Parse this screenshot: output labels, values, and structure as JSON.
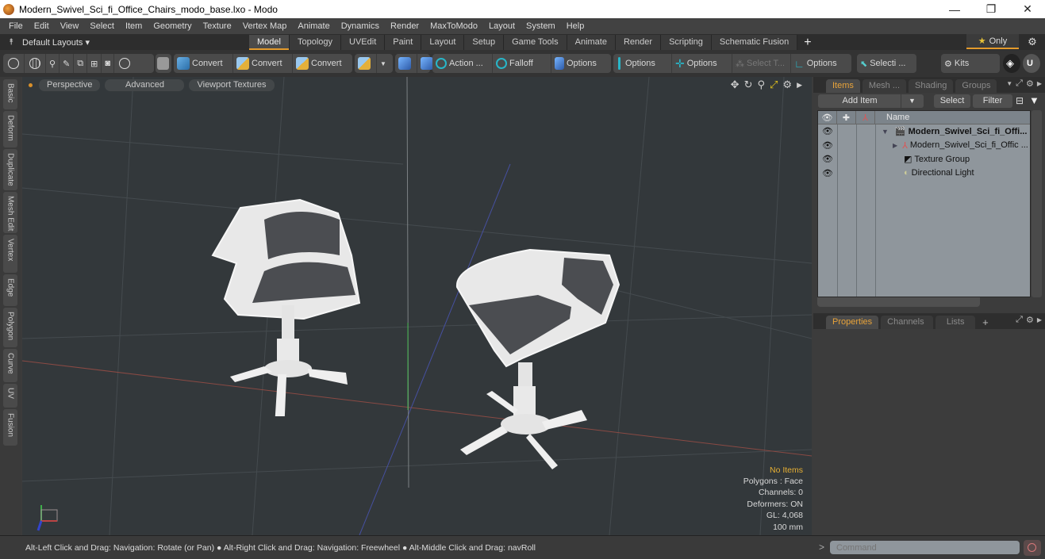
{
  "window": {
    "title": "Modern_Swivel_Sci_fi_Office_Chairs_modo_base.lxo - Modo",
    "minimize": "—",
    "restore": "❐",
    "close": "✕"
  },
  "menu": [
    "File",
    "Edit",
    "View",
    "Select",
    "Item",
    "Geometry",
    "Texture",
    "Vertex Map",
    "Animate",
    "Dynamics",
    "Render",
    "MaxToModo",
    "Layout",
    "System",
    "Help"
  ],
  "layout_bar": {
    "default_layouts": "Default Layouts ▾",
    "tabs": [
      "Model",
      "Topology",
      "UVEdit",
      "Paint",
      "Layout",
      "Setup",
      "Game Tools",
      "Animate",
      "Render",
      "Scripting",
      "Schematic Fusion"
    ],
    "active_tab": "Model",
    "add": "+",
    "only": "Only",
    "star": "★",
    "gear": "⚙"
  },
  "toolbar": {
    "convert1": "Convert",
    "convert2": "Convert",
    "convert3": "Convert",
    "action": "Action ...",
    "falloff": "Falloff",
    "options1": "Options",
    "options2": "Options",
    "options3": "Options",
    "select_t": "Select T...",
    "options4": "Options",
    "selecti": "Selecti ...",
    "kits": "Kits"
  },
  "side_tabs": [
    "Basic",
    "Deform",
    "Duplicate",
    "Mesh Edit",
    "Vertex",
    "Edge",
    "Polygon",
    "Curve",
    "UV",
    "Fusion"
  ],
  "viewport": {
    "perspective": "Perspective",
    "advanced": "Advanced",
    "viewport_textures": "Viewport Textures",
    "info": {
      "no_items": "No Items",
      "polygons": "Polygons : Face",
      "channels": "Channels: 0",
      "deformers": "Deformers: ON",
      "gl": "GL: 4,068",
      "units": "100 mm"
    }
  },
  "status": {
    "hint": "Alt-Left Click and Drag: Navigation: Rotate (or Pan) ● Alt-Right Click and Drag: Navigation: Freewheel ● Alt-Middle Click and Drag: navRoll"
  },
  "items_panel": {
    "tabs": [
      "Items",
      "Mesh ...",
      "Shading",
      "Groups"
    ],
    "active_tab": "Items",
    "add_item": "Add Item",
    "select": "Select",
    "filter": "Filter",
    "name_header": "Name",
    "rows": [
      {
        "label": "Modern_Swivel_Sci_fi_Offi...",
        "bold": true,
        "icon": "scene-icon"
      },
      {
        "label": "Modern_Swivel_Sci_fi_Offic ...",
        "bold": false,
        "icon": "mesh-icon"
      },
      {
        "label": "Texture Group",
        "bold": false,
        "icon": "texture-group-icon"
      },
      {
        "label": "Directional Light",
        "bold": false,
        "icon": "light-icon"
      }
    ]
  },
  "properties_panel": {
    "tabs": [
      "Properties",
      "Channels",
      "Lists"
    ],
    "active_tab": "Properties",
    "add": "+"
  },
  "command": {
    "prompt": ">",
    "placeholder": "Command"
  }
}
